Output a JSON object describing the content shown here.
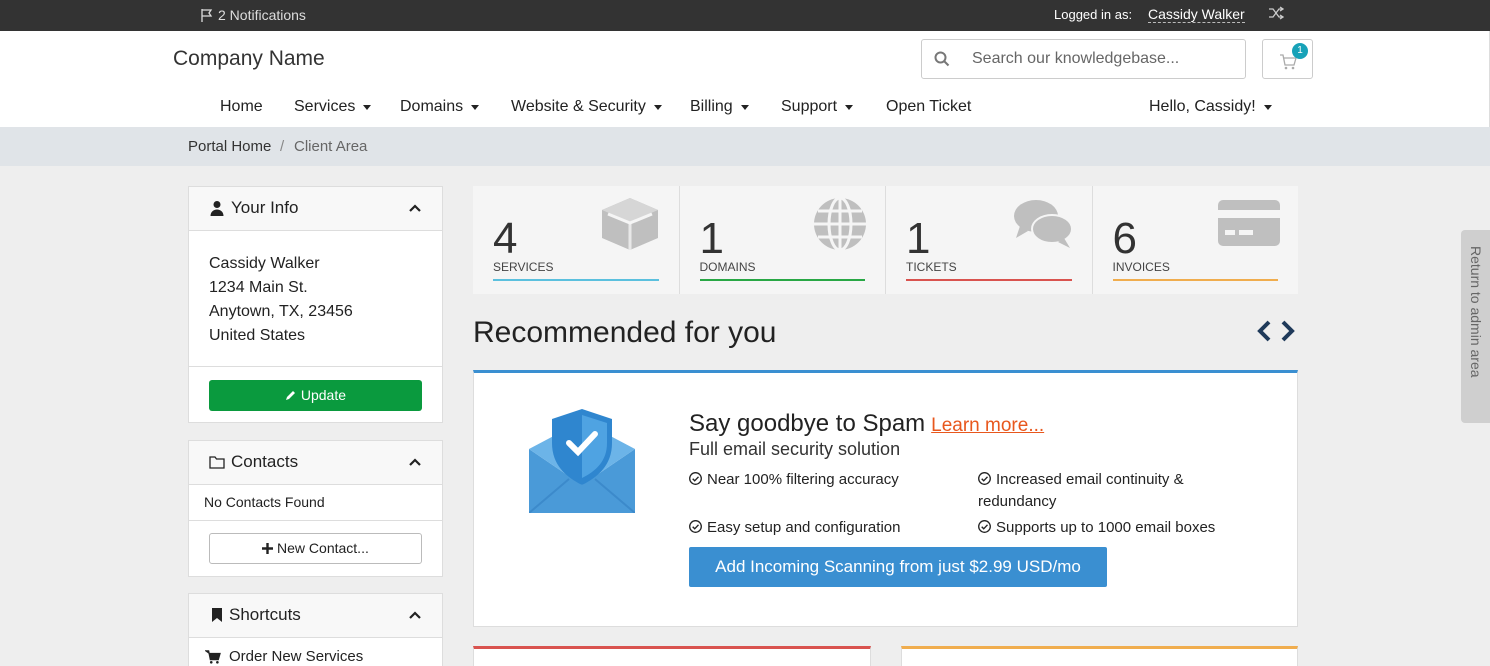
{
  "topbar": {
    "notifications": "2 Notifications",
    "logged_in_label": "Logged in as:",
    "user_name": "Cassidy Walker"
  },
  "header": {
    "brand": "Company Name",
    "search_placeholder": "Search our knowledgebase...",
    "cart_count": "1"
  },
  "nav": {
    "items": [
      {
        "label": "Home"
      },
      {
        "label": "Services"
      },
      {
        "label": "Domains"
      },
      {
        "label": "Website & Security"
      },
      {
        "label": "Billing"
      },
      {
        "label": "Support"
      },
      {
        "label": "Open Ticket"
      }
    ],
    "user_menu": "Hello, Cassidy!"
  },
  "breadcrumb": {
    "home": "Portal Home",
    "separator": "/",
    "current": "Client Area"
  },
  "your_info": {
    "title": "Your Info",
    "name": "Cassidy Walker",
    "address1": "1234 Main St.",
    "address2": "Anytown, TX, 23456",
    "country": "United States",
    "update_label": "Update"
  },
  "contacts": {
    "title": "Contacts",
    "empty": "No Contacts Found",
    "new_label": "New Contact..."
  },
  "shortcuts": {
    "title": "Shortcuts",
    "items": [
      {
        "label": "Order New Services"
      }
    ]
  },
  "tiles": [
    {
      "count": "4",
      "label": "SERVICES",
      "color": "#5bc0de",
      "icon": "cube-icon"
    },
    {
      "count": "1",
      "label": "DOMAINS",
      "color": "#28a745",
      "icon": "globe-icon"
    },
    {
      "count": "1",
      "label": "TICKETS",
      "color": "#d9534f",
      "icon": "comments-icon"
    },
    {
      "count": "6",
      "label": "INVOICES",
      "color": "#f0ad4e",
      "icon": "credit-card-icon"
    }
  ],
  "recommended": {
    "title": "Recommended for you",
    "headline": "Say goodbye to Spam",
    "learn_more": "Learn more...",
    "subtitle": "Full email security solution",
    "features": [
      "Near 100% filtering accuracy",
      "Increased email continuity & redundancy",
      "Easy setup and configuration",
      "Supports up to 1000 email boxes"
    ],
    "cta": "Add Incoming Scanning from just $2.99 USD/mo"
  },
  "side_tab": "Return to admin area",
  "colors": {
    "accent": "#3a8fd1",
    "update_green": "#0a9a3e",
    "link_orange": "#e8571d"
  }
}
